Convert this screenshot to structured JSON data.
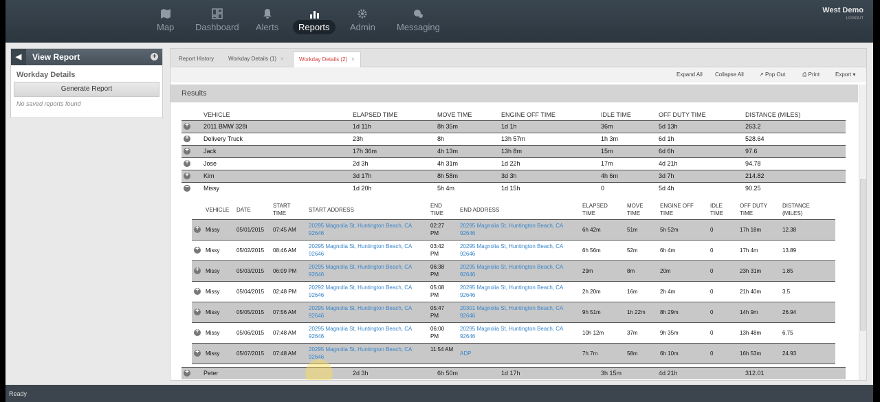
{
  "nav": {
    "items": [
      {
        "label": "Map",
        "icon": "map-icon"
      },
      {
        "label": "Dashboard",
        "icon": "dashboard-icon"
      },
      {
        "label": "Alerts",
        "icon": "bell-icon"
      },
      {
        "label": "Reports",
        "icon": "bar-chart-icon"
      },
      {
        "label": "Admin",
        "icon": "gear-icon"
      },
      {
        "label": "Messaging",
        "icon": "chat-icon"
      }
    ],
    "active": "Reports",
    "user": "West Demo",
    "logout": "LOGOUT"
  },
  "leftpanel": {
    "title": "View Report",
    "section": "Workday Details",
    "generate": "Generate Report",
    "empty": "No saved reports found"
  },
  "tabs": [
    {
      "label": "Report History"
    },
    {
      "label": "Workday Details (1)"
    },
    {
      "label": "Workday Details (2)"
    }
  ],
  "toolbar": {
    "expand": "Expand All",
    "collapse": "Collapse All",
    "popout": "Pop Out",
    "print": "Print",
    "export": "Export"
  },
  "results_title": "Results",
  "vehicle_table": {
    "headers": [
      "VEHICLE",
      "ELAPSED TIME",
      "MOVE TIME",
      "ENGINE OFF TIME",
      "IDLE TIME",
      "OFF DUTY TIME",
      "DISTANCE (MILES)"
    ],
    "rows": [
      [
        "2011 BMW 328i",
        "1d 11h",
        "8h 35m",
        "1d 1h",
        "36m",
        "5d 13h",
        "263.2"
      ],
      [
        "Delivery Truck",
        "23h",
        "8h",
        "13h 57m",
        "1h 3m",
        "6d 1h",
        "528.64"
      ],
      [
        "Jack",
        "17h 36m",
        "4h 13m",
        "13h 8m",
        "15m",
        "6d 6h",
        "97.6"
      ],
      [
        "Jose",
        "2d 3h",
        "4h 31m",
        "1d 22h",
        "17m",
        "4d 21h",
        "94.78"
      ],
      [
        "Kim",
        "3d 17h",
        "8h 58m",
        "3d 3h",
        "4h 6m",
        "3d 7h",
        "214.82"
      ],
      [
        "Missy",
        "1d 20h",
        "5h 4m",
        "1d 15h",
        "0",
        "5d 4h",
        "90.25"
      ]
    ],
    "last_row": [
      "Peter",
      "2d 3h",
      "6h 50m",
      "1d 17h",
      "3h 15m",
      "4d 21h",
      "312.01"
    ]
  },
  "detail_table": {
    "headers": [
      "VEHICLE",
      "DATE",
      "START TIME",
      "START ADDRESS",
      "END TIME",
      "END ADDRESS",
      "ELAPSED TIME",
      "MOVE TIME",
      "ENGINE OFF TIME",
      "IDLE TIME",
      "OFF DUTY TIME",
      "DISTANCE (MILES)"
    ],
    "rows": [
      [
        "Missy",
        "05/01/2015",
        "07:45 AM",
        "20295 Magnolia St, Huntington Beach, CA 92646",
        "02:27 PM",
        "20295 Magnolia St, Huntington Beach, CA 92646",
        "6h 42m",
        "51m",
        "5h 52m",
        "0",
        "17h 18m",
        "12.38"
      ],
      [
        "Missy",
        "05/02/2015",
        "08:46 AM",
        "20295 Magnolia St, Huntington Beach, CA 92646",
        "03:42 PM",
        "20295 Magnolia St, Huntington Beach, CA 92646",
        "6h 56m",
        "52m",
        "6h 4m",
        "0",
        "17h 4m",
        "13.89"
      ],
      [
        "Missy",
        "05/03/2015",
        "06:09 PM",
        "20295 Magnolia St, Huntington Beach, CA 92646",
        "06:38 PM",
        "20295 Magnolia St, Huntington Beach, CA 92646",
        "29m",
        "8m",
        "20m",
        "0",
        "23h 31m",
        "1.85"
      ],
      [
        "Missy",
        "05/04/2015",
        "02:48 PM",
        "20292 Magnolia St, Huntington Beach, CA 92646",
        "05:08 PM",
        "20295 Magnolia St, Huntington Beach, CA 92646",
        "2h 20m",
        "16m",
        "2h 4m",
        "0",
        "21h 40m",
        "3.5"
      ],
      [
        "Missy",
        "05/05/2015",
        "07:56 AM",
        "20295 Magnolia St, Huntington Beach, CA 92646",
        "05:47 PM",
        "20301 Magnolia St, Huntington Beach, CA 92646",
        "9h 51m",
        "1h 22m",
        "8h 29m",
        "0",
        "14h 9m",
        "26.94"
      ],
      [
        "Missy",
        "05/06/2015",
        "07:48 AM",
        "20295 Magnolia St, Huntington Beach, CA 92646",
        "06:00 PM",
        "20295 Magnolia St, Huntington Beach, CA 92646",
        "10h 12m",
        "37m",
        "9h 35m",
        "0",
        "13h 48m",
        "6.75"
      ],
      [
        "Missy",
        "05/07/2015",
        "07:48 AM",
        "20295 Magnolia St, Huntington Beach, CA 92646",
        "11:54 AM",
        "ADP",
        "7h 7m",
        "58m",
        "6h 10m",
        "0",
        "16h 53m",
        "24.93"
      ]
    ]
  },
  "status": "Ready"
}
